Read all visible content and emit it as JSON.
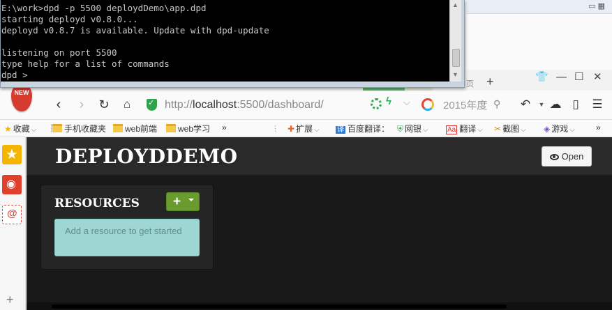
{
  "console": {
    "lines": [
      "E:\\work>dpd -p 5500 deploydDemo\\app.dpd",
      "starting deployd v0.8.0...",
      "deployd v0.8.7 is available. Update with dpd-update",
      "",
      "listening on port 5500",
      "type help for a list of commands",
      "dpd > "
    ]
  },
  "browser": {
    "new_badge": "NEW",
    "url_prefix": "http://",
    "url_host": "localhost",
    "url_rest": ":5500/dashboard/",
    "search_text": "2015年度",
    "bookmarks": [
      {
        "label": "收藏",
        "icon": "star-icon",
        "caret": "⌵"
      },
      {
        "label": "手机收藏夹",
        "icon": "folder-icon"
      },
      {
        "label": "web前端",
        "icon": "folder-icon"
      },
      {
        "label": "web学习",
        "icon": "folder-icon"
      },
      {
        "label": "»",
        "icon": ""
      },
      {
        "label": "扩展",
        "icon": "puzzle-icon",
        "caret": "⌵"
      },
      {
        "label": "百度翻译：",
        "icon": "translate-icon"
      },
      {
        "label": "网银",
        "icon": "shield-icon",
        "caret": "⌵"
      },
      {
        "label": "翻译",
        "icon": "dict-icon",
        "caret": "⌵"
      },
      {
        "label": "截图",
        "icon": "screenshot-icon",
        "caret": "⌵"
      },
      {
        "label": "游戏",
        "icon": "game-icon",
        "caret": "⌵"
      },
      {
        "label": "»",
        "icon": ""
      }
    ]
  },
  "dashboard": {
    "app_title": "DEPLOYDDEMO",
    "open_label": "Open",
    "resources_title": "RESOURCES",
    "add_label": "+",
    "empty_message": "Add a resource to get started"
  },
  "colors": {
    "page_bg": "#1c1c1c",
    "add_button": "#6a9b2f",
    "empty_hint_bg": "#9fd6d3",
    "console_bg": "#000000"
  }
}
